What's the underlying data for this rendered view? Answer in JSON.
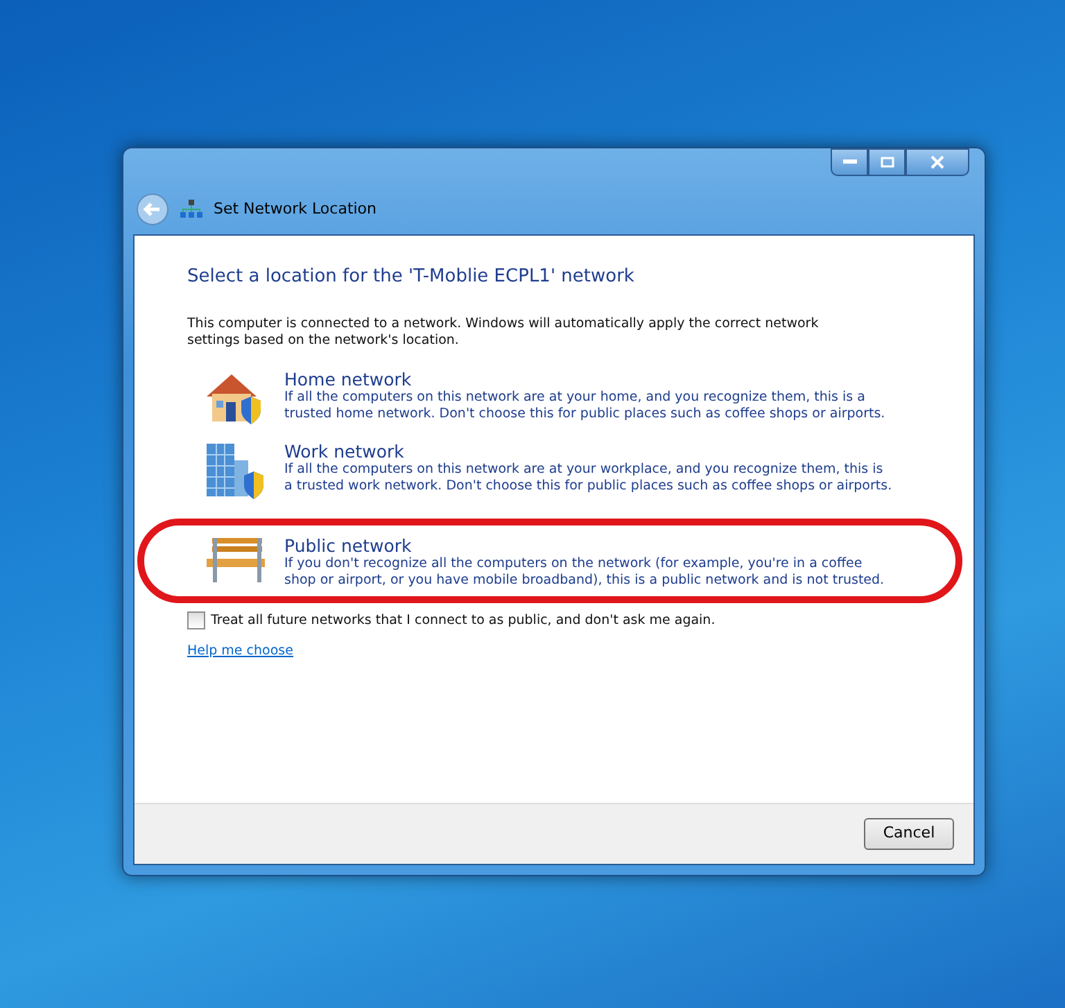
{
  "window": {
    "title": "Set Network Location"
  },
  "heading": "Select a location for the 'T-Moblie ECPL1' network",
  "intro": "This computer is connected to a network. Windows will automatically apply the correct network settings based on the network's location.",
  "locations": [
    {
      "kind": "home",
      "title": "Home network",
      "description": "If all the computers on this network are at your home, and you recognize them, this is a trusted home network.  Don't choose this for public places such as coffee shops or airports."
    },
    {
      "kind": "work",
      "title": "Work network",
      "description": "If all the computers on this network are at your workplace, and you recognize them, this is a trusted work network.  Don't choose this for public places such as coffee shops or airports."
    },
    {
      "kind": "public",
      "title": "Public network",
      "description": "If you don't recognize all the computers on the network (for example, you're in a coffee shop or airport, or you have mobile broadband), this is a public network and is not trusted."
    }
  ],
  "public_checkbox": {
    "label": "Treat all future networks that I connect to as public, and don't ask me again.",
    "checked": false
  },
  "help_link": "Help me choose",
  "buttons": [
    "Cancel"
  ]
}
